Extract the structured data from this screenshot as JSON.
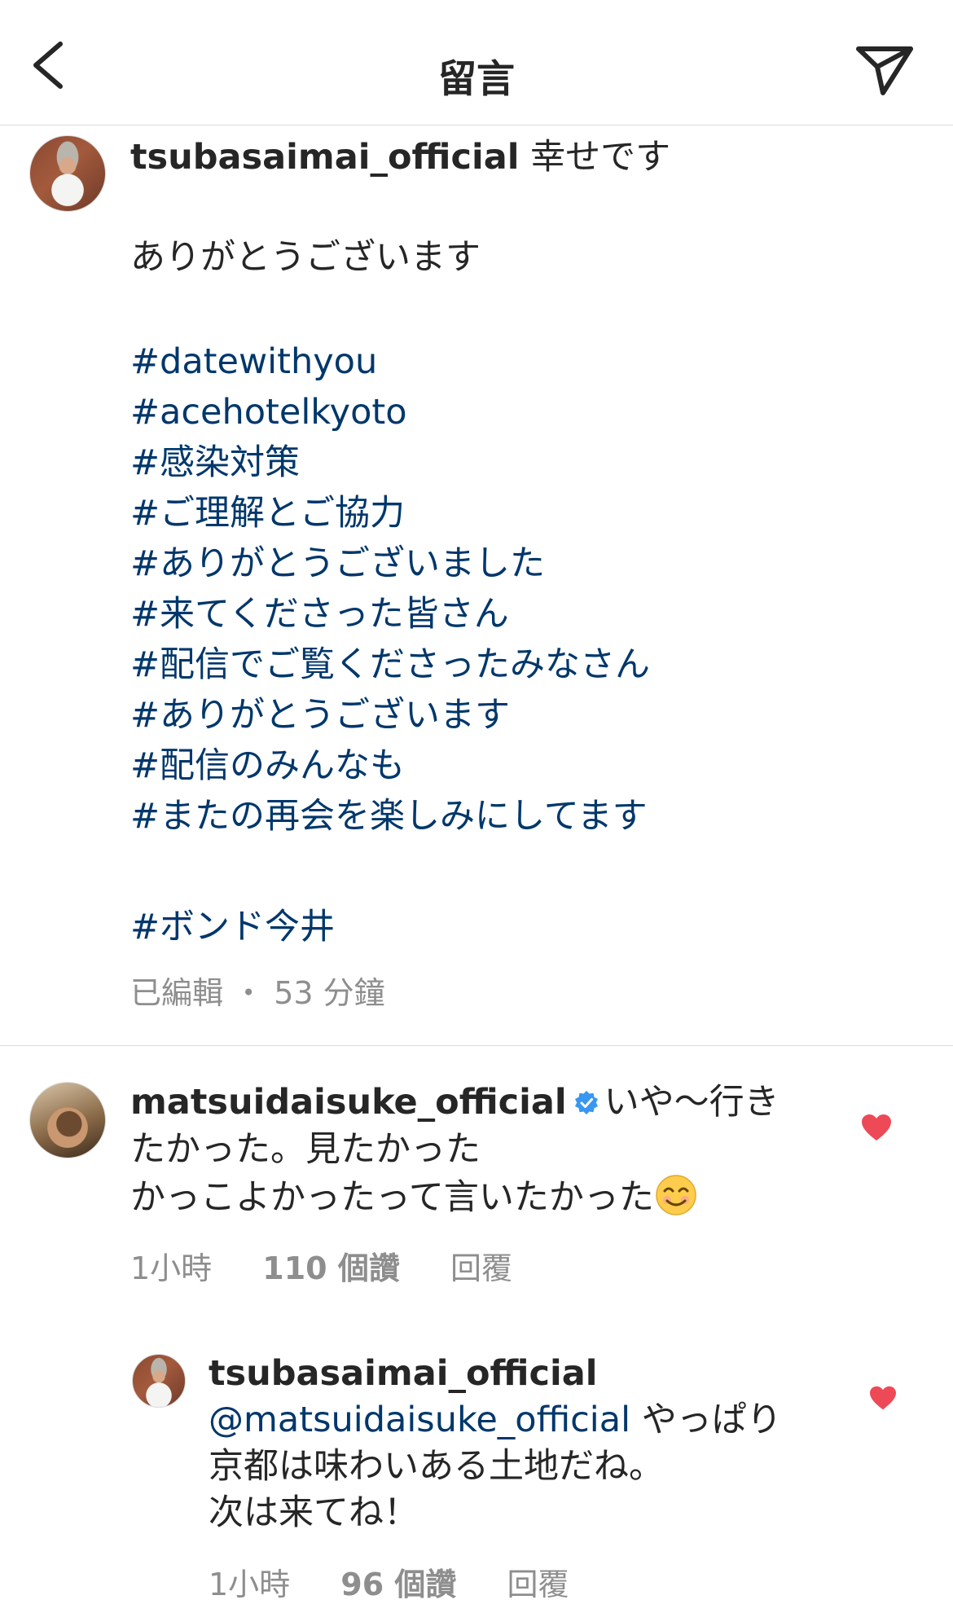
{
  "header": {
    "title": "留言",
    "back_icon": "chevron-left-icon",
    "share_icon": "paper-plane-icon"
  },
  "caption": {
    "username": "tsubasaimai_official",
    "line1_text": "幸せです",
    "line2_text": "ありがとうございます",
    "hashtags": [
      "#datewithyou",
      "#acehotelkyoto",
      "#感染対策",
      "#ご理解とご協力",
      "#ありがとうございました",
      "#来てくださった皆さん",
      "#配信でご覧くださったみなさん",
      "#ありがとうございます",
      "#配信のみんなも",
      "#またの再会を楽しみにしてます"
    ],
    "final_hashtag": "#ボンド今井",
    "edited_label": "已編輯",
    "separator": "・",
    "time": "53 分鐘"
  },
  "comment": {
    "username": "matsuidaisuke_official",
    "text_part1": "いや～行き",
    "text_line2": "たかった。見たかった",
    "text_line3": "かっこよかったって言いたかった",
    "emoji": "smiling-face-icon",
    "time": "1小時",
    "likes": "110 個讚",
    "reply_label": "回覆",
    "liked": true
  },
  "reply": {
    "username": "tsubasaimai_official",
    "mention": "@matsuidaisuke_official",
    "text_part1": "やっぱり",
    "text_line2": "京都は味わいある土地だね。",
    "text_line3": "次は来てね！",
    "time": "1小時",
    "likes": "96 個讚",
    "reply_label": "回覆",
    "liked": true
  },
  "colors": {
    "hashtag": "#00376b",
    "heart": "#ed4956",
    "verified": "#3897f0",
    "meta": "#8e8e8e"
  }
}
